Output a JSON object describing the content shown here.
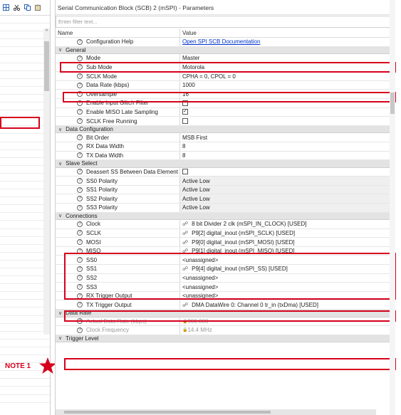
{
  "window": {
    "title": "Serial Communication Block (SCB) 2 (mSPI) - Parameters"
  },
  "filter": {
    "placeholder": "Enter filter text..."
  },
  "columns": {
    "name": "Name",
    "value": "Value"
  },
  "config_help": {
    "label": "Configuration Help",
    "value": "Open SPI SCB Documentation"
  },
  "groups": [
    {
      "title": "General",
      "rows": [
        {
          "label": "Mode",
          "value": "Master",
          "type": "text"
        },
        {
          "label": "Sub Mode",
          "value": "Motorola",
          "type": "text"
        },
        {
          "label": "SCLK Mode",
          "value": "CPHA = 0, CPOL = 0",
          "type": "text"
        },
        {
          "label": "Data Rate (kbps)",
          "value": "1000",
          "type": "text"
        },
        {
          "label": "Oversample",
          "value": "16",
          "type": "text"
        },
        {
          "label": "Enable Input Glitch Filter",
          "value": "",
          "type": "checkbox",
          "checked": false
        },
        {
          "label": "Enable MISO Late Sampling",
          "value": "",
          "type": "checkbox",
          "checked": true
        },
        {
          "label": "SCLK Free Running",
          "value": "",
          "type": "checkbox",
          "checked": false
        }
      ]
    },
    {
      "title": "Data Configuration",
      "rows": [
        {
          "label": "Bit Order",
          "value": "MSB First",
          "type": "text"
        },
        {
          "label": "RX Data Width",
          "value": "8",
          "type": "text"
        },
        {
          "label": "TX Data Width",
          "value": "8",
          "type": "text"
        }
      ]
    },
    {
      "title": "Slave Select",
      "rows": [
        {
          "label": "Deassert SS Between Data Element",
          "value": "",
          "type": "checkbox",
          "checked": false
        },
        {
          "label": "SS0 Polarity",
          "value": "Active Low",
          "type": "gray"
        },
        {
          "label": "SS1 Polarity",
          "value": "Active Low",
          "type": "gray"
        },
        {
          "label": "SS2 Polarity",
          "value": "Active Low",
          "type": "gray"
        },
        {
          "label": "SS3 Polarity",
          "value": "Active Low",
          "type": "gray"
        }
      ]
    },
    {
      "title": "Connections",
      "rows": [
        {
          "label": "Clock",
          "value": "8 bit Divider 2 clk (mSPI_IN_CLOCK) [USED]",
          "type": "link"
        },
        {
          "label": "SCLK",
          "value": "P9[2] digital_inout (mSPI_SCLK) [USED]",
          "type": "link"
        },
        {
          "label": "MOSI",
          "value": "P9[0] digital_inout (mSPI_MOSI) [USED]",
          "type": "link"
        },
        {
          "label": "MISO",
          "value": "P9[1] digital_inout (mSPI_MISO) [USED]",
          "type": "link"
        },
        {
          "label": "SS0",
          "value": "<unassigned>",
          "type": "text"
        },
        {
          "label": "SS1",
          "value": "P9[4] digital_inout (mSPI_SS) [USED]",
          "type": "link"
        },
        {
          "label": "SS2",
          "value": "<unassigned>",
          "type": "text"
        },
        {
          "label": "SS3",
          "value": "<unassigned>",
          "type": "text"
        },
        {
          "label": "RX Trigger Output",
          "value": "<unassigned>",
          "type": "text"
        },
        {
          "label": "TX Trigger Output",
          "value": "DMA DataWire 0: Channel 0 tr_in (txDma) [USED]",
          "type": "link"
        }
      ]
    },
    {
      "title": "Data Rate",
      "rows": [
        {
          "label": "Actual Data Rate (kbps)",
          "value": "900.000",
          "type": "dim"
        },
        {
          "label": "Clock Frequency",
          "value": "14.4 MHz",
          "type": "dim"
        }
      ]
    },
    {
      "title": "Trigger Level",
      "rows": []
    }
  ],
  "annotation": {
    "note": "NOTE 1"
  },
  "colors": {
    "highlight": "#d6001c",
    "link": "#0033cc",
    "category_bg": "#e3e3e3"
  },
  "icons": {
    "help": "help-circle-icon",
    "link": "chain-link-icon",
    "expand": "chevron-down-icon",
    "lock": "lock-icon"
  }
}
